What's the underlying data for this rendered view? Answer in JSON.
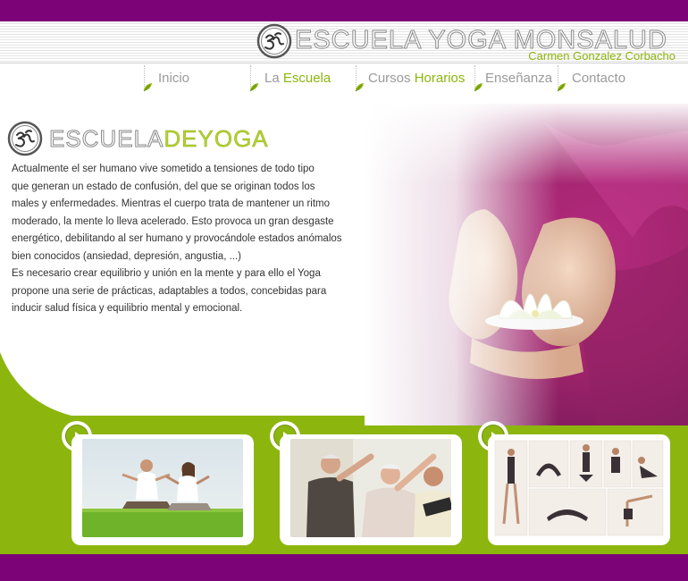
{
  "header": {
    "title": "ESCUELA YOGA MONSALUD",
    "subtitle": "Carmen Gonzalez Corbacho",
    "logo_icon": "om-icon"
  },
  "nav": {
    "items": [
      {
        "plain": "Inicio",
        "accent": ""
      },
      {
        "plain": "La ",
        "accent": "Escuela"
      },
      {
        "plain": "Cursos ",
        "accent": "Horarios"
      },
      {
        "plain": "Enseñanza",
        "accent": ""
      },
      {
        "plain": "Contacto",
        "accent": ""
      }
    ],
    "leaf_icon": "leaf-icon"
  },
  "content": {
    "title_plain": "ESCUELA",
    "title_accent": "DEYOGA",
    "paragraph": "Actualmente el ser humano vive sometido a tensiones de todo tipo\nque generan un estado de confusión, del que se originan todos los\nmales y enfermedades. Mientras el cuerpo trata de mantener un ritmo\nmoderado, la mente lo lleva acelerado. Esto provoca un gran desgaste\n energético, debilitando al ser humano y provocándole estados anómalos\n bien conocidos (ansiedad, depresión, angustia, ...)\nEs necesario crear equilibrio y unión en la mente y para ello el Yoga\npropone una serie de prácticas,  adaptables a todos, concebidas para\ninducir salud física y equilibrio mental y emocional."
  },
  "thumbnails": [
    {
      "name": "couple-meditating-photo"
    },
    {
      "name": "seniors-stretching-photo"
    },
    {
      "name": "yoga-poses-collage-photo"
    }
  ],
  "colors": {
    "purple": "#7c0277",
    "green": "#8cb60e",
    "magenta": "#a0246c"
  }
}
